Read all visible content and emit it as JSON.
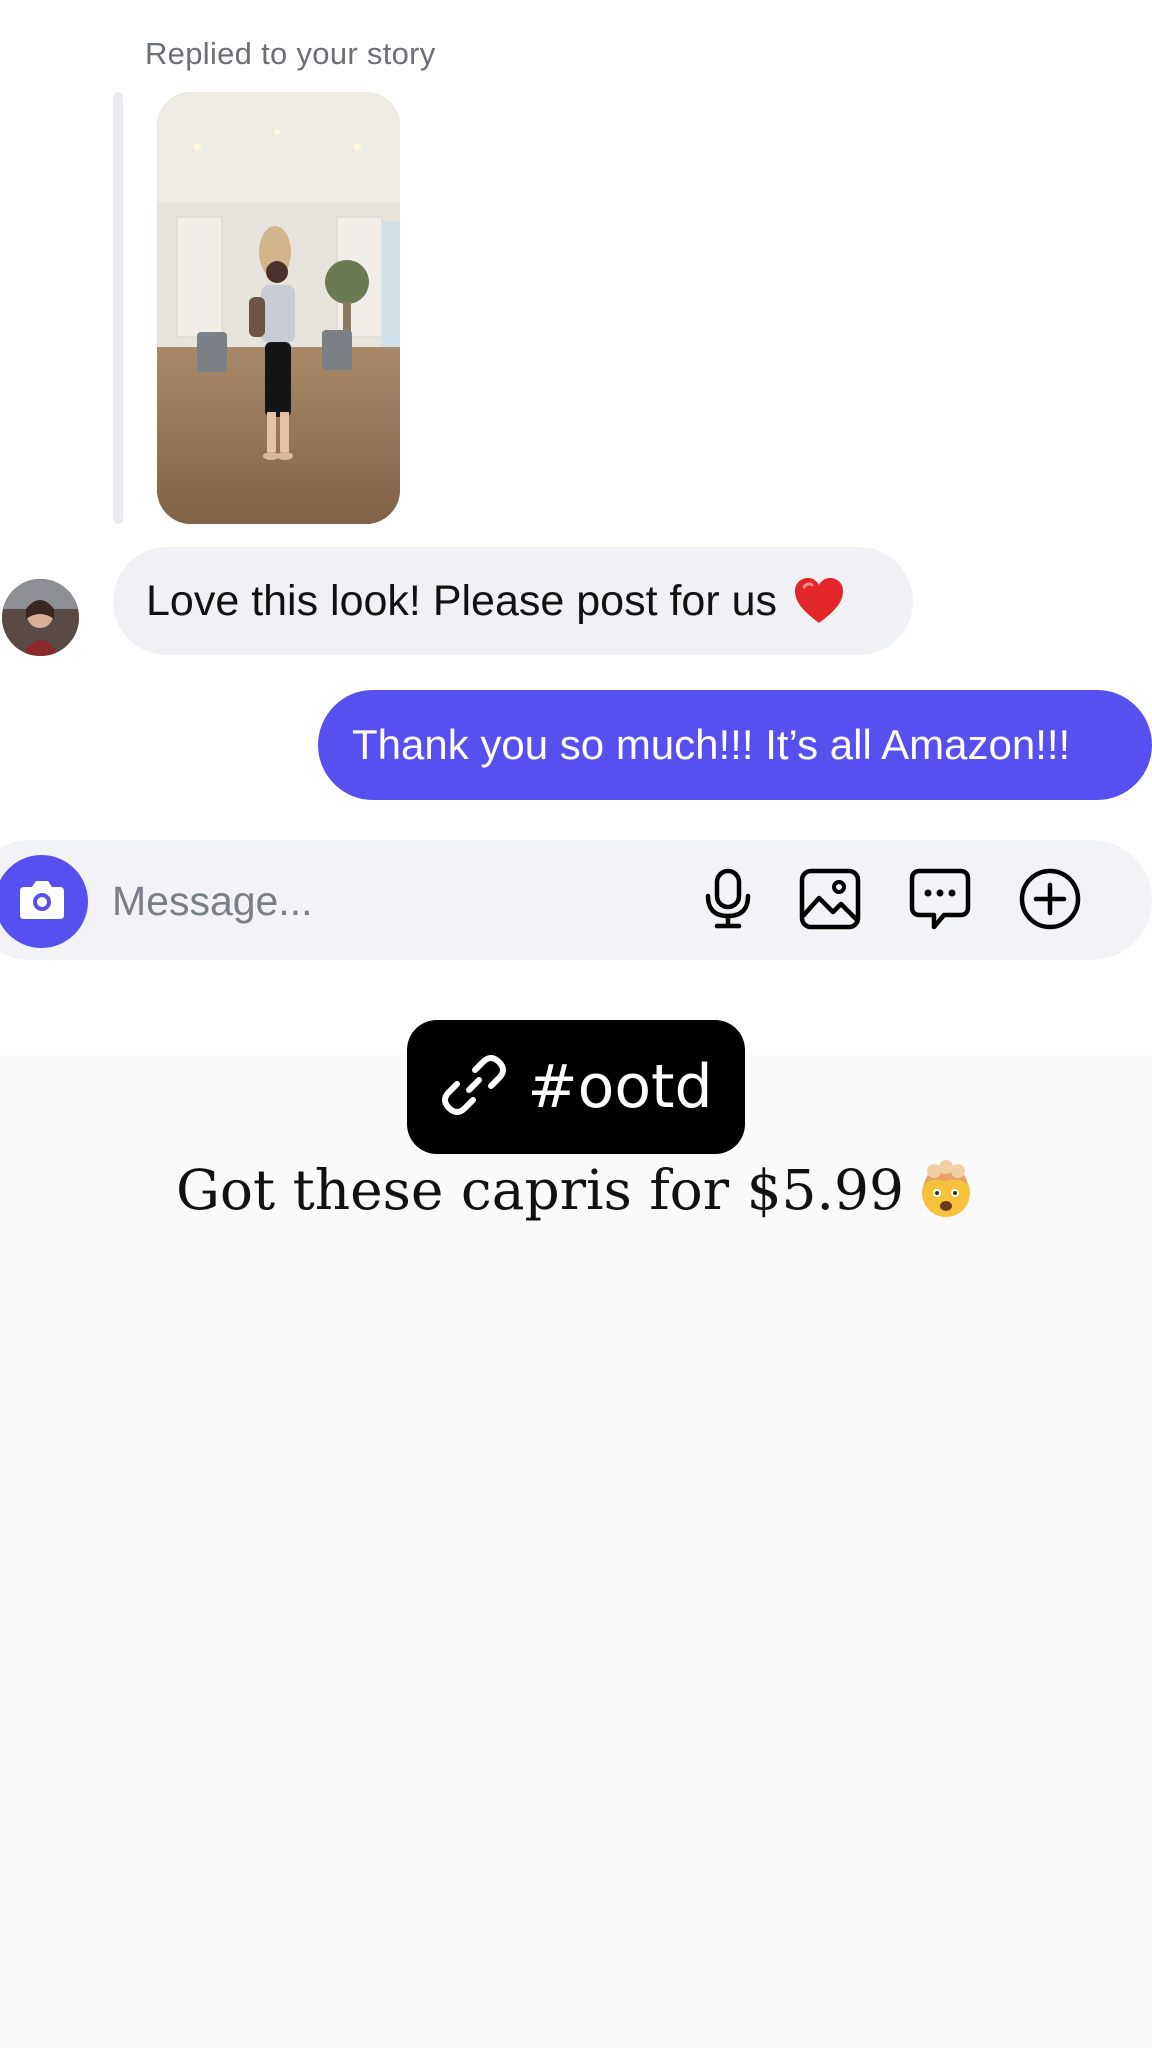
{
  "story_reply": {
    "label": "Replied to your story"
  },
  "messages": [
    {
      "direction": "incoming",
      "text": "Love this look! Please post for us",
      "emoji": "red-heart"
    },
    {
      "direction": "outgoing",
      "text": "Thank you so much!!! It’s all Amazon!!!"
    }
  ],
  "composer": {
    "placeholder": "Message...",
    "icons": [
      "camera-icon",
      "microphone-icon",
      "image-icon",
      "sticker-chat-icon",
      "plus-circle-icon"
    ]
  },
  "story_overlay": {
    "hashtag": "#ootd",
    "caption": "Got these capris for $5.99",
    "caption_emoji": "exploding-head"
  },
  "colors": {
    "accent": "#5750f0",
    "incoming_bubble": "#f0f1f5",
    "composer_bg": "#f2f3f6"
  }
}
